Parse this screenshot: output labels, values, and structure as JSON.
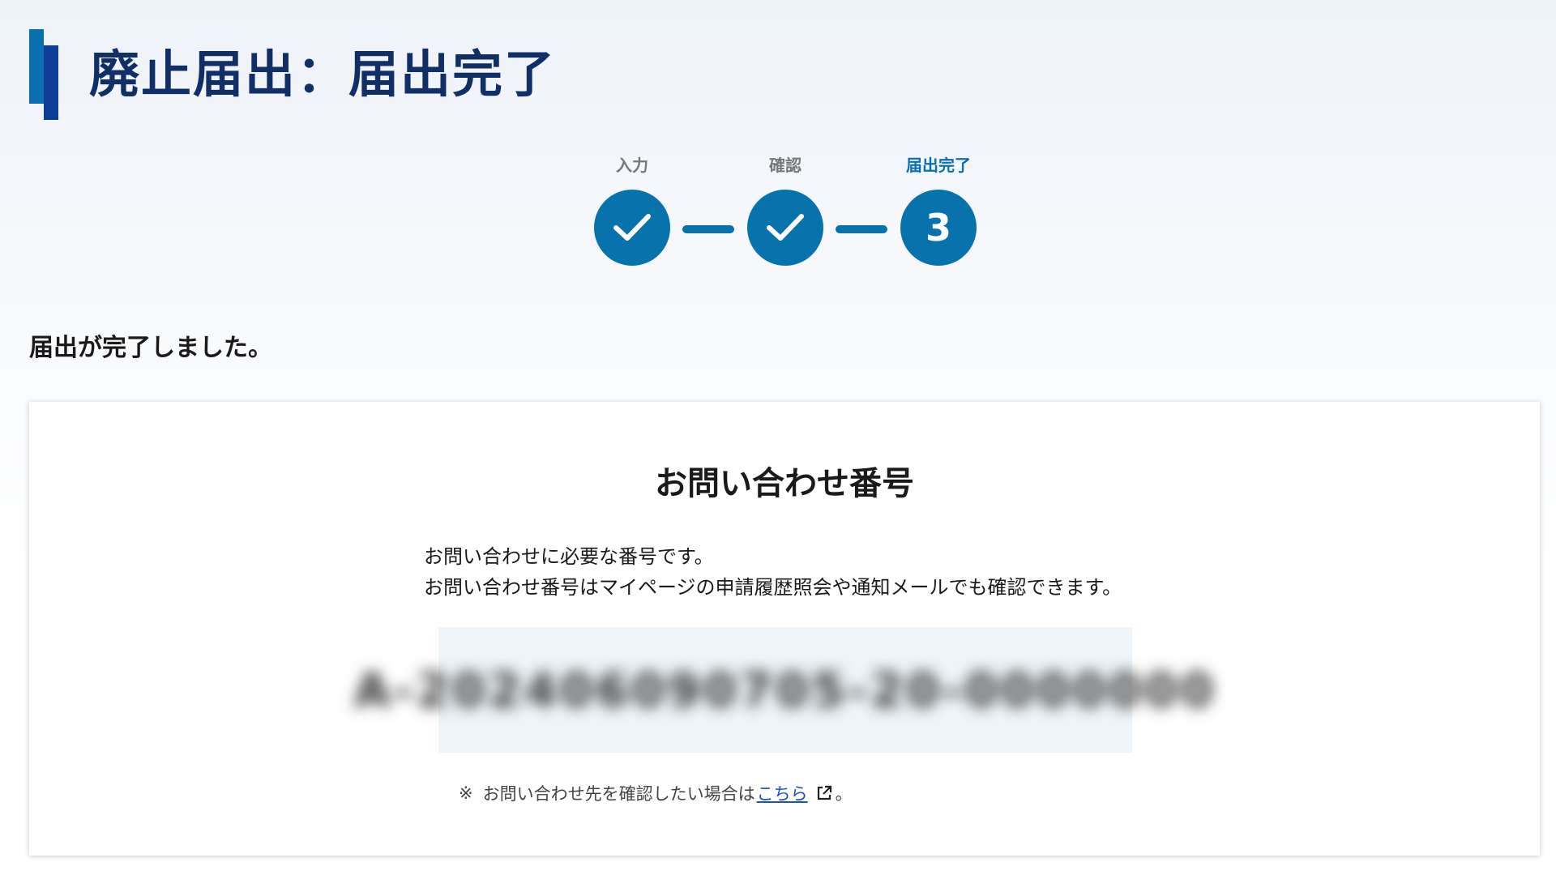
{
  "header": {
    "title": "廃止届出：届出完了"
  },
  "stepper": {
    "steps": [
      {
        "label": "入力",
        "status": "done",
        "icon": "check-icon"
      },
      {
        "label": "確認",
        "status": "done",
        "icon": "check-icon"
      },
      {
        "label": "届出完了",
        "status": "current",
        "number": "3"
      }
    ],
    "accent_color": "#0872ad"
  },
  "message": {
    "complete": "届出が完了しました。"
  },
  "inquiry": {
    "title": "お問い合わせ番号",
    "description_line1": "お問い合わせに必要な番号です。",
    "description_line2": "お問い合わせ番号はマイページの申請履歴照会や通知メールでも確認できます。",
    "number": "A-202406090705-20-0000000",
    "number_blurred": true,
    "note_mark": "※",
    "note_text": "お問い合わせ先を確認したい場合は",
    "note_link": "こちら",
    "note_link_icon": "external-link-icon",
    "note_end": "。"
  },
  "colors": {
    "title_text": "#0f2f66",
    "title_bar_light": "#0a6fb0",
    "title_bar_dark": "#0d3d96",
    "link": "#1a52c6"
  }
}
